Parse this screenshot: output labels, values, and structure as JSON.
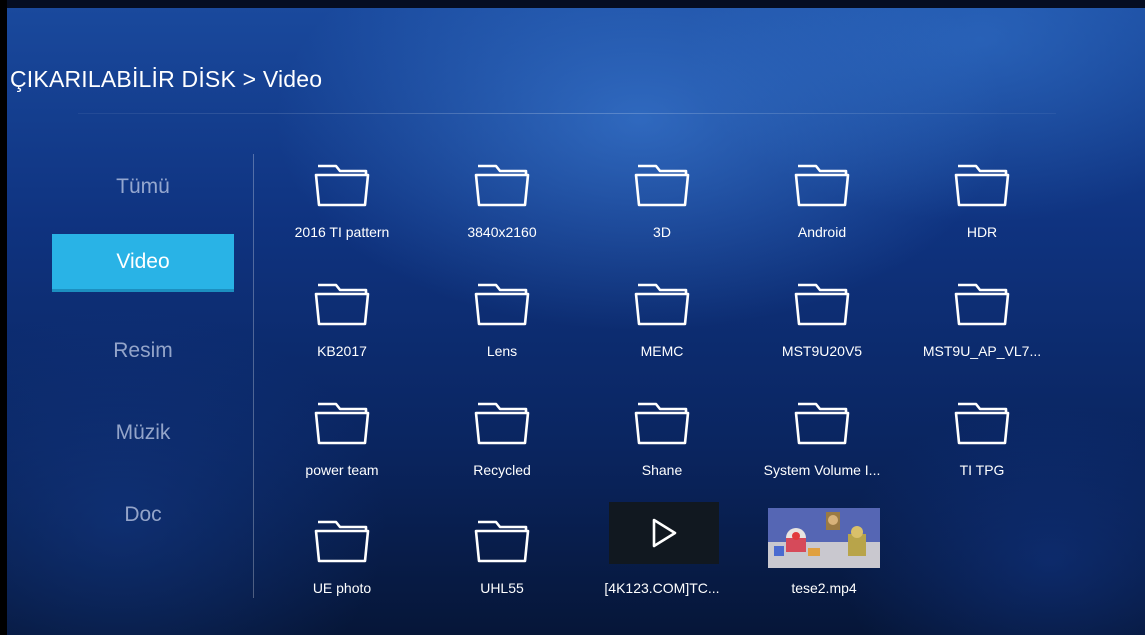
{
  "header": {
    "breadcrumb": "ÇIKARILABİLİR DİSK > Video"
  },
  "sidebar": {
    "items": [
      {
        "label": "Tümü",
        "active": false
      },
      {
        "label": "Video",
        "active": true
      },
      {
        "label": "Resim",
        "active": false
      },
      {
        "label": "Müzik",
        "active": false
      },
      {
        "label": "Doc",
        "active": false
      }
    ]
  },
  "files": [
    {
      "label": "2016 TI pattern",
      "type": "folder"
    },
    {
      "label": "3840x2160",
      "type": "folder"
    },
    {
      "label": "3D",
      "type": "folder"
    },
    {
      "label": "Android",
      "type": "folder"
    },
    {
      "label": "HDR",
      "type": "folder"
    },
    {
      "label": "KB2017",
      "type": "folder"
    },
    {
      "label": "Lens",
      "type": "folder"
    },
    {
      "label": "MEMC",
      "type": "folder"
    },
    {
      "label": "MST9U20V5",
      "type": "folder"
    },
    {
      "label": "MST9U_AP_VL7...",
      "type": "folder"
    },
    {
      "label": "power team",
      "type": "folder"
    },
    {
      "label": "Recycled",
      "type": "folder"
    },
    {
      "label": "Shane",
      "type": "folder"
    },
    {
      "label": "System Volume I...",
      "type": "folder"
    },
    {
      "label": "TI TPG",
      "type": "folder"
    },
    {
      "label": "UE photo",
      "type": "folder"
    },
    {
      "label": "UHL55",
      "type": "folder"
    },
    {
      "label": "[4K123.COM]TC...",
      "type": "video",
      "icon": "play-icon"
    },
    {
      "label": "tese2.mp4",
      "type": "video-thumbnail"
    }
  ],
  "colors": {
    "accent": "#29b3e6",
    "background": "#0f3380"
  }
}
